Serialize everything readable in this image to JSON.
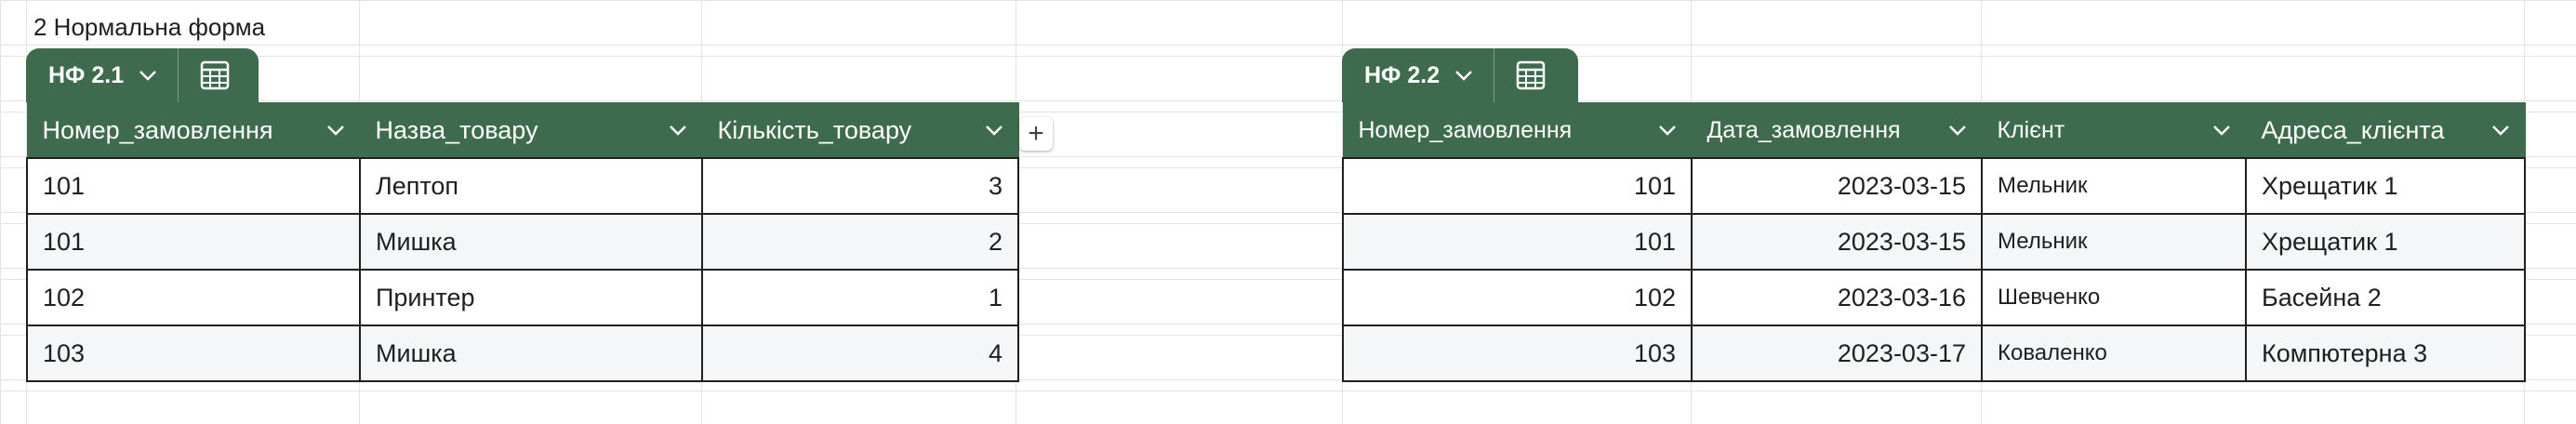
{
  "sheet_title": "2 Нормальна форма",
  "tables": [
    {
      "tab_name": "НФ 2.1",
      "columns": [
        "Номер_замовлення",
        "Назва_товару",
        "Кількість_товару"
      ],
      "rows": [
        [
          "101",
          "Лептоп",
          "3"
        ],
        [
          "101",
          "Мишка",
          "2"
        ],
        [
          "102",
          "Принтер",
          "1"
        ],
        [
          "103",
          "Мишка",
          "4"
        ]
      ]
    },
    {
      "tab_name": "НФ 2.2",
      "columns": [
        "Номер_замовлення",
        "Дата_замовлення",
        "Клієнт",
        "Адреса_клієнта"
      ],
      "rows": [
        [
          "101",
          "2023-03-15",
          "Мельник",
          "Хрещатик 1"
        ],
        [
          "101",
          "2023-03-15",
          "Мельник",
          "Хрещатик 1"
        ],
        [
          "102",
          "2023-03-16",
          "Шевченко",
          "Басейна 2"
        ],
        [
          "103",
          "2023-03-17",
          "Коваленко",
          "Компютерна 3"
        ]
      ]
    }
  ],
  "add_column_icon": "+",
  "colors": {
    "header_bg": "#3e6b4e",
    "header_text": "#ffffff",
    "alt_row": "#f4f6f7"
  }
}
